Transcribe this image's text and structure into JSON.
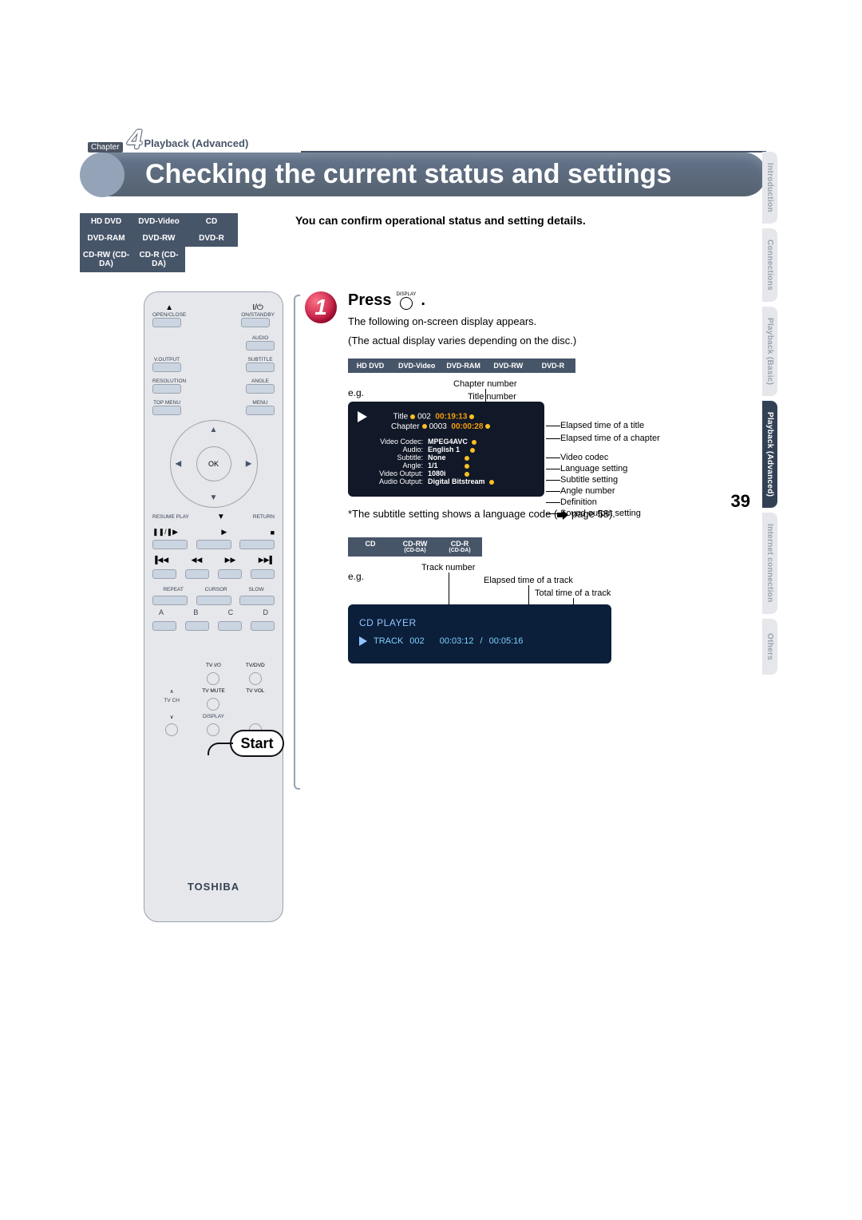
{
  "chapter": {
    "label": "Chapter",
    "number": "4",
    "section": "Playback (Advanced)"
  },
  "title": "Checking the current status and settings",
  "intro": "You can confirm operational status and setting details.",
  "disc_table": [
    [
      "HD DVD",
      "DVD-Video",
      "CD"
    ],
    [
      "DVD-RAM",
      "DVD-RW",
      "DVD-R"
    ],
    [
      "CD-RW (CD-DA)",
      "CD-R (CD-DA)",
      ""
    ]
  ],
  "remote": {
    "brand": "TOSHIBA",
    "start_label": "Start",
    "labels": {
      "open_close": "OPEN/CLOSE",
      "on_standby": "ON/STANDBY",
      "audio": "AUDIO",
      "voutput": "V.OUTPUT",
      "subtitle": "SUBTITLE",
      "resolution": "RESOLUTION",
      "angle": "ANGLE",
      "topmenu": "TOP MENU",
      "menu": "MENU",
      "ok": "OK",
      "resume": "RESUME PLAY",
      "return": "RETURN",
      "repeat": "REPEAT",
      "cursor": "CURSOR",
      "slow": "SLOW",
      "abcd": [
        "A",
        "B",
        "C",
        "D"
      ],
      "tvpwr": "TV I/⏻",
      "tvdvd": "TV/DVD",
      "tvmute": "TV MUTE",
      "tvvol": "TV VOL",
      "tvch": "TV CH",
      "display": "DISPLAY"
    }
  },
  "step": {
    "number": "1",
    "press_word": "Press",
    "press_icon_label": "DISPLAY",
    "period": ".",
    "desc1": "The following on-screen display appears.",
    "desc2": "(The actual display varies depending on the disc.)"
  },
  "fmt_row_dvd": [
    "HD DVD",
    "DVD-Video",
    "DVD-RAM",
    "DVD-RW",
    "DVD-R"
  ],
  "eg_label": "e.g.",
  "osd_dvd": {
    "title_label": "Title",
    "title_num": "002",
    "title_time": "00:19:13",
    "chapter_label": "Chapter",
    "chapter_num": "0003",
    "chapter_time": "00:00:28",
    "rows": [
      {
        "k": "Video Codec:",
        "v": "MPEG4AVC"
      },
      {
        "k": "Audio:",
        "v": "English 1"
      },
      {
        "k": "Subtitle:",
        "v": "None"
      },
      {
        "k": "Angle:",
        "v": "1/1"
      },
      {
        "k": "Video Output:",
        "v": "1080i"
      },
      {
        "k": "Audio Output:",
        "v": "Digital Bitstream"
      }
    ]
  },
  "annot_dvd_top": {
    "chapter_number": "Chapter number",
    "title_number": "Title number"
  },
  "annot_dvd_right": [
    "Elapsed time of a title",
    "Elapsed time of a chapter",
    "Video codec",
    "Language setting",
    "Subtitle setting",
    "Angle number",
    "Definition",
    "Sound output setting"
  ],
  "footnote": {
    "prefix": "*The subtitle setting shows a language code (",
    "page_ref": " page 58).",
    "page_word": ""
  },
  "fmt_row_cd": [
    {
      "main": "CD",
      "sub": ""
    },
    {
      "main": "CD-RW",
      "sub": "(CD-DA)"
    },
    {
      "main": "CD-R",
      "sub": "(CD-DA)"
    }
  ],
  "annot_cd_top": {
    "track_number": "Track number",
    "elapsed": "Elapsed time of a track",
    "total": "Total time of a track"
  },
  "osd_cd": {
    "header": "CD PLAYER",
    "track_word": "TRACK",
    "track_num": "002",
    "elapsed": "00:03:12",
    "sep": "/",
    "total": "00:05:16"
  },
  "side_tabs": [
    {
      "label": "Introduction",
      "active": false
    },
    {
      "label": "Connections",
      "active": false
    },
    {
      "label": "Playback (Basic)",
      "active": false
    },
    {
      "label": "Playback (Advanced)",
      "active": true
    },
    {
      "label": "Internet connection",
      "active": false
    },
    {
      "label": "Others",
      "active": false
    }
  ],
  "page_number": "39"
}
